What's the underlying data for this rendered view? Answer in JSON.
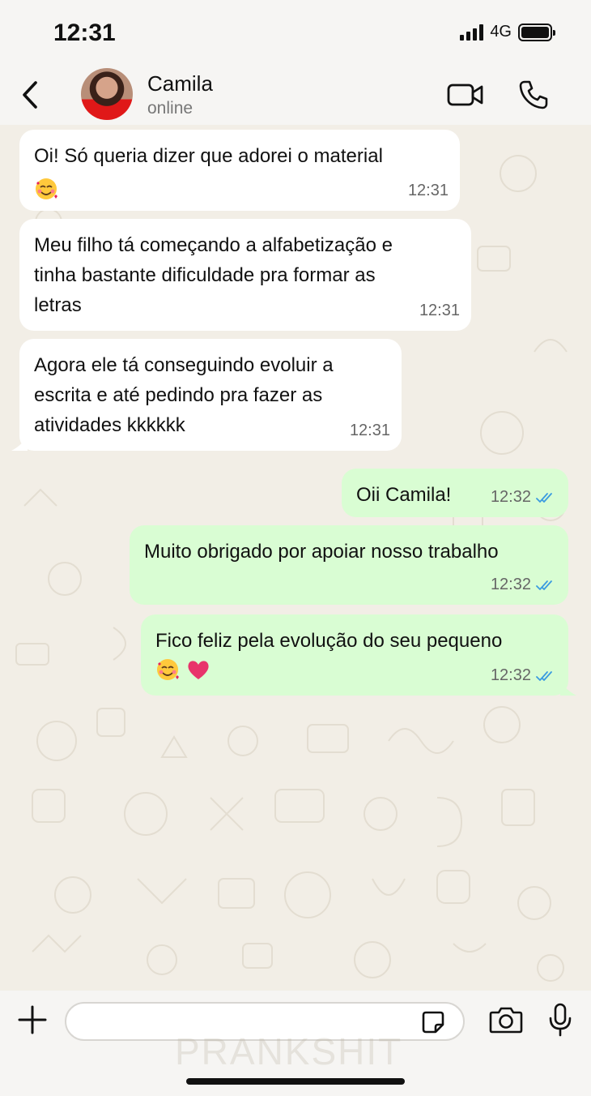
{
  "status_bar": {
    "time": "12:31",
    "network": "4G"
  },
  "header": {
    "contact_name": "Camila",
    "contact_status": "online"
  },
  "messages": [
    {
      "direction": "in",
      "text": "Oi! Só queria dizer que adorei o material",
      "emoji": [
        "smiling-face-with-hearts"
      ],
      "time": "12:31"
    },
    {
      "direction": "in",
      "text": "Meu filho tá começando a alfabetização e\ntinha bastante dificuldade pra formar as\nletras",
      "time": "12:31"
    },
    {
      "direction": "in",
      "text": "Agora ele tá conseguindo evoluir a\nescrita e até pedindo pra fazer as\natividades kkkkkk",
      "time": "12:31"
    },
    {
      "direction": "out",
      "text": "Oii Camila!",
      "time": "12:32",
      "read": true
    },
    {
      "direction": "out",
      "text": "Muito obrigado por apoiar nosso trabalho",
      "time": "12:32",
      "read": true
    },
    {
      "direction": "out",
      "text": "Fico feliz pela evolução do seu pequeno",
      "emoji": [
        "smiling-face-with-hearts",
        "heart"
      ],
      "time": "12:32",
      "read": true
    }
  ],
  "watermark": "PRANKSHIT",
  "composer": {
    "input_value": "",
    "input_placeholder": ""
  },
  "colors": {
    "incoming_bubble": "#ffffff",
    "outgoing_bubble": "#d9fdd3",
    "read_ticks": "#53bdeb",
    "wallpaper": "#f2eee6"
  }
}
